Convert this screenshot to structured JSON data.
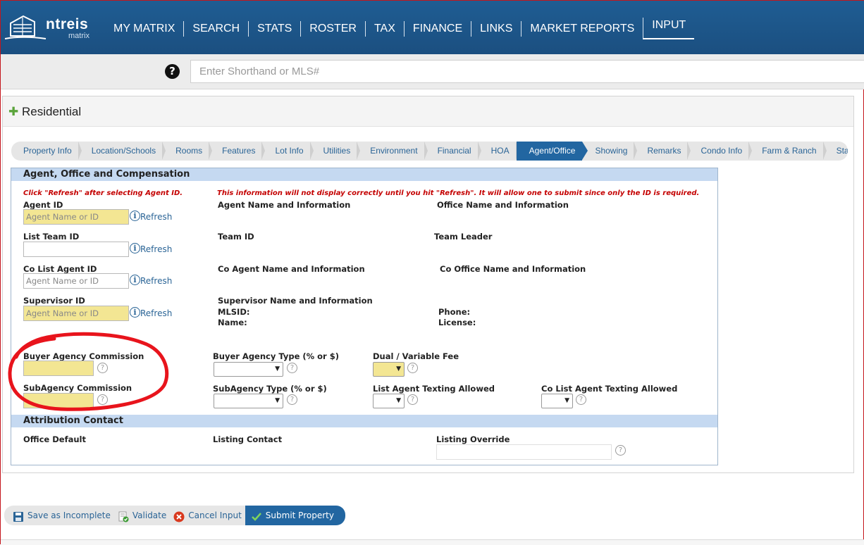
{
  "logo": {
    "word": "ntreis",
    "sub": "matrix"
  },
  "nav": [
    "MY MATRIX",
    "SEARCH",
    "STATS",
    "ROSTER",
    "TAX",
    "FINANCE",
    "LINKS",
    "MARKET REPORTS",
    "INPUT"
  ],
  "search": {
    "placeholder": "Enter Shorthand or MLS#",
    "help_glyph": "?"
  },
  "panel": {
    "title": "Residential"
  },
  "tabs": [
    "Property Info",
    "Location/Schools",
    "Rooms",
    "Features",
    "Lot Info",
    "Utilities",
    "Environment",
    "Financial",
    "HOA",
    "Agent/Office",
    "Showing",
    "Remarks",
    "Condo Info",
    "Farm & Ranch",
    "Status"
  ],
  "active_tab": "Agent/Office",
  "form": {
    "section1": "Agent, Office and Compensation",
    "note_left": "Click \"Refresh\" after selecting Agent ID.",
    "note_right": "This information will not display correctly until you hit \"Refresh\".  It will allow one to submit since only the ID is required.",
    "agent_id": "Agent ID",
    "agent_name_info": "Agent Name and Information",
    "office_name_info": "Office Name and Information",
    "list_team_id": "List Team ID",
    "team_id": "Team ID",
    "team_leader": "Team Leader",
    "co_list_agent_id": "Co List Agent ID",
    "co_agent_name_info": "Co Agent Name and Information",
    "co_office_name_info": "Co Office Name and Information",
    "supervisor_id": "Supervisor ID",
    "supervisor_name_info": "Supervisor Name and Information",
    "mlsid": "MLSID:",
    "name": "Name:",
    "phone": "Phone:",
    "license": "License:",
    "agent_placeholder": "Agent Name or ID",
    "refresh": "Refresh",
    "buyer_agency_commission": "Buyer Agency Commission",
    "buyer_agency_type": "Buyer Agency Type (% or $)",
    "dual_variable_fee": "Dual / Variable Fee",
    "subagency_commission": "SubAgency Commission",
    "subagency_type": "SubAgency Type (% or $)",
    "list_agent_texting": "List Agent Texting Allowed",
    "co_list_agent_texting": "Co List Agent Texting Allowed",
    "section2": "Attribution Contact",
    "office_default": "Office Default",
    "listing_contact": "Listing Contact",
    "listing_override": "Listing Override"
  },
  "actions": {
    "save": "Save as Incomplete",
    "validate": "Validate",
    "cancel": "Cancel Input",
    "submit": "Submit Property"
  },
  "colors": {
    "nav_bg": "#1f5d93",
    "tab_active": "#2266a1",
    "required_field": "#f3e693",
    "section_bar": "#c5d9f1",
    "annotation": "#e8141c"
  }
}
